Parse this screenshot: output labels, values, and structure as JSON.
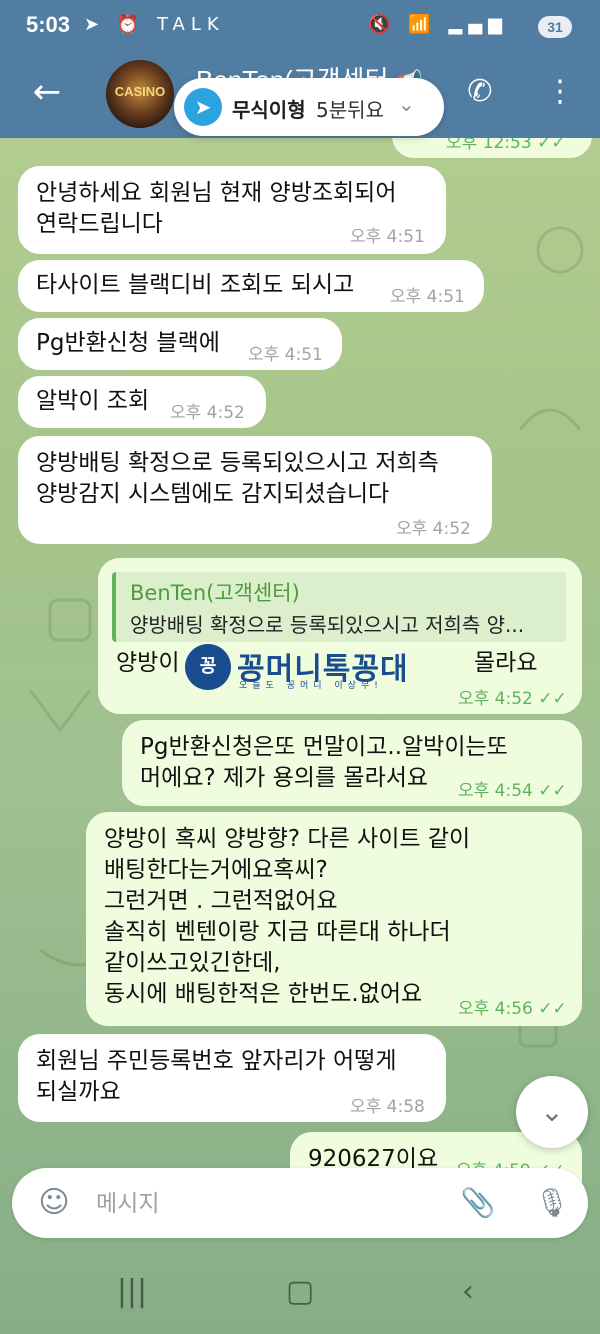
{
  "status_bar": {
    "time": "5:03",
    "left_icons": "➤ ⏰ TALK",
    "right_icons": "🔇 📶 ▂▄▆",
    "battery": "31"
  },
  "app_bar": {
    "title": "BenTen(고객센터",
    "mute_icon": "📢"
  },
  "music_player": {
    "artist": "무식이형",
    "song": "5분뒤요"
  },
  "messages": [
    {
      "dir": "out",
      "text": "",
      "time": "오후 12:53",
      "status": "✓✓"
    },
    {
      "dir": "in",
      "text": "안녕하세요 회원님 현재 양방조회되어\n연락드립니다",
      "time": "오후 4:51"
    },
    {
      "dir": "in",
      "text": "타사이트 블랙디비 조회도 되시고",
      "time": "오후 4:51"
    },
    {
      "dir": "in",
      "text": "Pg반환신청 블랙에",
      "time": "오후 4:51"
    },
    {
      "dir": "in",
      "text": "알박이 조회",
      "time": "오후 4:52"
    },
    {
      "dir": "in",
      "text": "양방배팅 확정으로 등록되있으시고 저희측\n양방감지 시스템에도 감지되셨습니다",
      "time": "오후 4:52"
    },
    {
      "dir": "out",
      "quote_name": "BenTen(고객센터)",
      "quote_text": "양방배팅 확정으로 등록되있으시고 저희측 양...",
      "text_left": "양방이",
      "text_right": "몰라요",
      "time": "오후 4:52",
      "status": "✓✓"
    },
    {
      "dir": "out",
      "text": "Pg반환신청은또 먼말이고..알박이는또\n머에요? 제가 용의를 몰라서요",
      "time": "오후 4:54",
      "status": "✓✓"
    },
    {
      "dir": "out",
      "text": "양방이 혹씨 양방향? 다른 사이트 같이\n배팅한다는거에요혹씨?\n그런거면 . 그런적없어요\n솔직히 벤텐이랑 지금 따른대 하나더\n같이쓰고있긴한데,\n동시에 배팅한적은 한번도.없어요",
      "time": "오후 4:56",
      "status": "✓✓"
    },
    {
      "dir": "in",
      "text": "회원님 주민등록번호 앞자리가 어떻게\n되실까요",
      "time": "오후 4:58"
    },
    {
      "dir": "out",
      "text": "920627이요",
      "time": "오후 4:59",
      "status": "✓✓"
    }
  ],
  "watermark": {
    "text": "꽁머니톡꽁대",
    "sub": "오늘도 꽁머니 이상무!"
  },
  "input": {
    "placeholder": "메시지"
  },
  "icons": {
    "back": "back-arrow-icon",
    "call": "phone-icon",
    "more": "more-vertical-icon",
    "emoji": "emoji-icon",
    "attach": "paperclip-icon",
    "mic": "microphone-icon",
    "scroll_down": "chevron-down-icon"
  },
  "colors": {
    "header": "#517da2",
    "incoming_bubble": "#ffffff",
    "outgoing_bubble": "#effdde",
    "outgoing_meta": "#5fb35e"
  }
}
